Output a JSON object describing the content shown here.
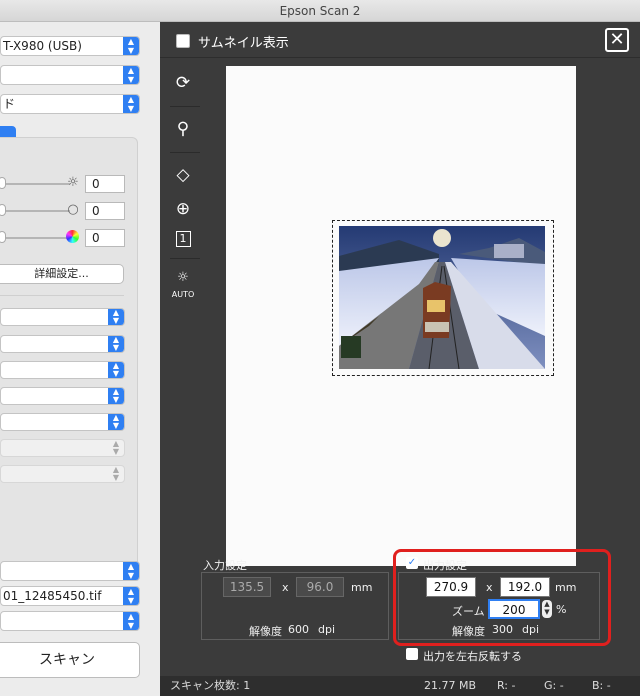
{
  "window": {
    "title": "Epson Scan 2"
  },
  "left_panel": {
    "scanner_select": "T-X980 (USB)",
    "select2": "",
    "mode_select": "ド",
    "brightness_value": "0",
    "contrast_value": "0",
    "saturation_value": "0",
    "advanced_button": "詳細設定...",
    "filename": "01_12485450.tif",
    "scan_button": "スキャン"
  },
  "preview": {
    "thumbnail_label": "サムネイル表示",
    "close_label": "✕",
    "auto_label": "AUTO",
    "count_badge": "1"
  },
  "input_settings": {
    "title": "入力設定",
    "width": "135.5",
    "height": "96.0",
    "x_sep": "x",
    "unit": "mm",
    "resolution_label": "解像度",
    "resolution": "600",
    "resolution_unit": "dpi"
  },
  "output_settings": {
    "checkbox_label": "出力設定",
    "width": "270.9",
    "height": "192.0",
    "x_sep": "x",
    "unit": "mm",
    "zoom_label": "ズーム",
    "zoom": "200",
    "zoom_unit": "%",
    "resolution_label": "解像度",
    "resolution": "300",
    "resolution_unit": "dpi"
  },
  "mirror_label": "出力を左右反転する",
  "status_bar": {
    "scan_count": "スキャン枚数: 1",
    "file_size": "21.77 MB",
    "r": "R:  -",
    "g": "G:  -",
    "b": "B:  -"
  },
  "colors": {
    "accent": "#2f7ff2",
    "highlight": "#e0201e",
    "dark_bg": "#3b3b3b"
  }
}
